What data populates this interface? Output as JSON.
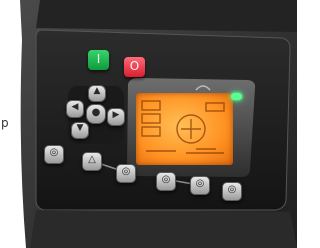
{
  "photo": {
    "subject": "Control panel with LCD display and push buttons",
    "edge_text": "p",
    "colors": {
      "panel": "#3a3a3a",
      "bezel": "#1c1c1c",
      "lcd_glow": "#ff9a2b",
      "led": "#4dff85",
      "start_button": "#22c15a",
      "stop_button": "#f03b4a",
      "key_button": "#cfcfcf"
    },
    "buttons": [
      {
        "name": "start-button",
        "icon": "power-on-icon",
        "symbol": "I"
      },
      {
        "name": "stop-button",
        "icon": "power-off-icon",
        "symbol": "O"
      },
      {
        "name": "nav-up-button",
        "icon": "arrow-up-icon"
      },
      {
        "name": "nav-left-button",
        "icon": "arrow-left-icon"
      },
      {
        "name": "nav-center-button",
        "icon": "enter-icon"
      },
      {
        "name": "nav-right-button",
        "icon": "arrow-right-icon"
      },
      {
        "name": "nav-down-button",
        "icon": "arrow-down-icon"
      },
      {
        "name": "function-button-1",
        "icon": "function-icon"
      },
      {
        "name": "function-button-2",
        "icon": "warning-icon"
      },
      {
        "name": "function-button-3",
        "icon": "function-icon"
      },
      {
        "name": "function-button-4",
        "icon": "function-icon"
      },
      {
        "name": "function-button-5",
        "icon": "function-icon"
      },
      {
        "name": "function-button-6",
        "icon": "function-icon"
      }
    ]
  }
}
